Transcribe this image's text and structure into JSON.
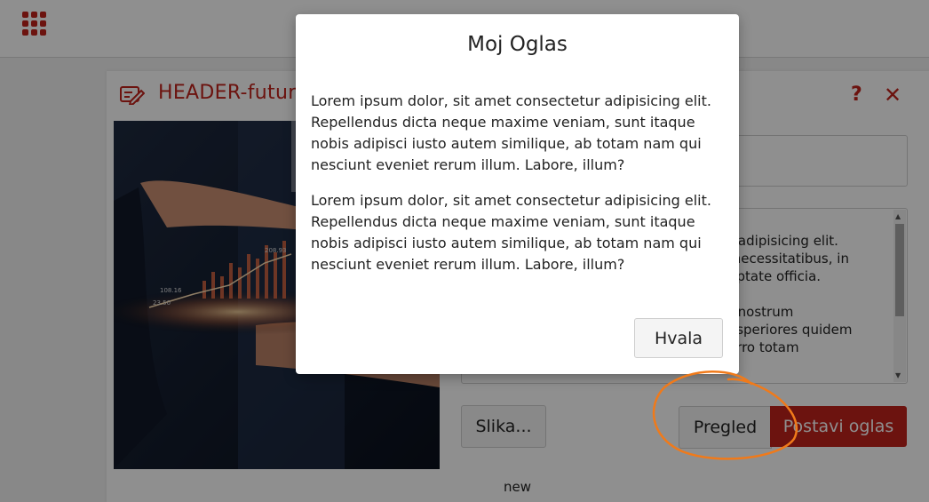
{
  "header": {
    "menu_icon": "grid-menu-icon"
  },
  "panel": {
    "title": "HEADER-futur",
    "title_icon": "pencil-edit-icon",
    "help_label": "?",
    "close_label": "✕",
    "textarea_visible_text": "r adipisicing elit.\n necessitatibus, in\nuptate officia.\n\nt nostrum\nasperiores quidem\norro totam",
    "buttons": {
      "image": "Slika...",
      "preview": "Pregled",
      "publish": "Postavi oglas"
    },
    "status": "new"
  },
  "modal": {
    "title": "Moj Oglas",
    "paragraphs": [
      "Lorem ipsum dolor, sit amet consectetur adipisicing elit. Repellendus dicta neque maxime veniam, sunt itaque nobis adipisci iusto autem similique, ab totam nam qui nesciunt eveniet rerum illum. Labore, illum?",
      "Lorem ipsum dolor, sit amet consectetur adipisicing elit. Repellendus dicta neque maxime veniam, sunt itaque nobis adipisci iusto autem similique, ab totam nam qui nesciunt eveniet rerum illum. Labore, illum?"
    ],
    "button": "Hvala"
  },
  "photo_chart_labels": [
    "208.93",
    "108.16",
    "23.50"
  ],
  "colors": {
    "accent": "#c0221b",
    "annotation": "#f07a1a"
  }
}
